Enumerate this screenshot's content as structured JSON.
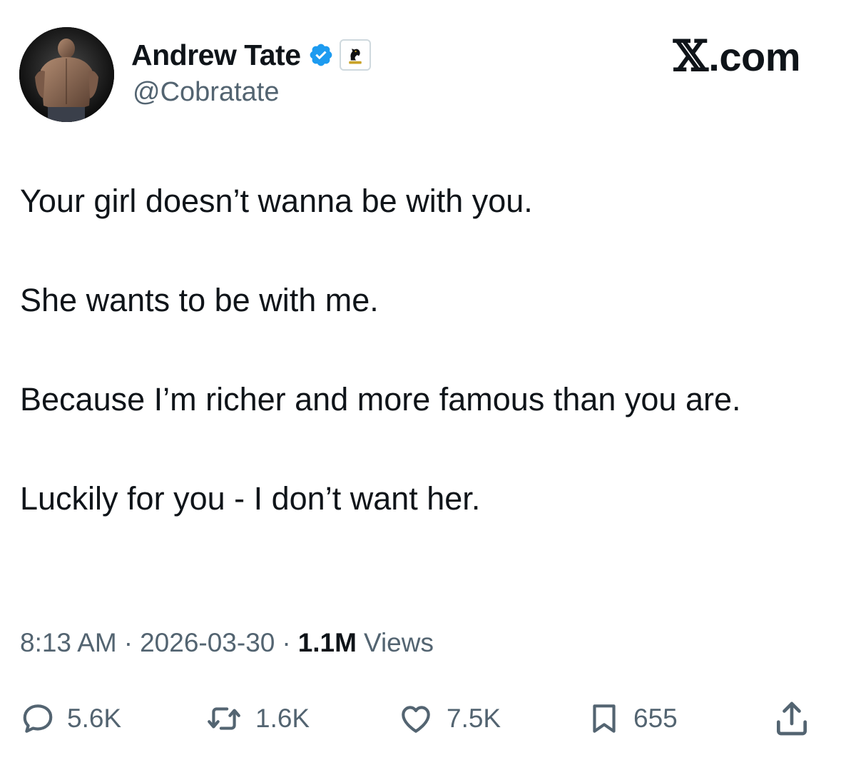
{
  "author": {
    "display_name": "Andrew Tate",
    "handle": "@Cobratate",
    "verified": true,
    "badge_color": "#1d9bf0"
  },
  "site": {
    "logo_x": "𝕏",
    "logo_suffix": ".com"
  },
  "tweet": {
    "paragraphs": [
      "Your girl doesn’t wanna be with you.",
      "She wants to be with me.",
      "Because I’m richer and more famous than you are.",
      "Luckily for you - I don’t want her."
    ]
  },
  "meta": {
    "time": "8:13 AM",
    "separator": "·",
    "date": "2026-03-30",
    "views_count": "1.1M",
    "views_label": "Views"
  },
  "actions": {
    "replies": "5.6K",
    "reposts": "1.6K",
    "likes": "7.5K",
    "bookmarks": "655"
  },
  "icons": {
    "reply": "reply-icon",
    "repost": "repost-icon",
    "like": "heart-icon",
    "bookmark": "bookmark-icon",
    "share": "share-icon",
    "verified": "verified-badge-icon",
    "affiliate": "chess-knight-icon"
  },
  "colors": {
    "text_primary": "#0f1419",
    "text_secondary": "#536471",
    "verified_blue": "#1d9bf0"
  }
}
